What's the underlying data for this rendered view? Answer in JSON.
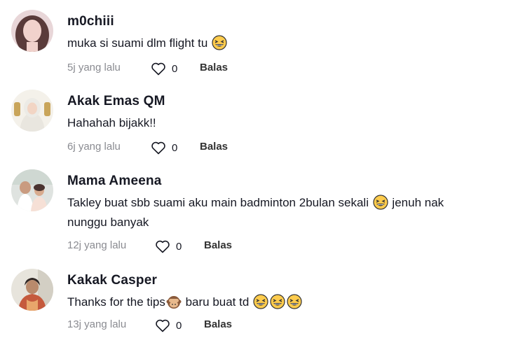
{
  "comments": [
    {
      "username": "m0chiii",
      "text_before": "muka si suami dlm flight tu ",
      "emoji_after": "grinning-squinting-emoji",
      "time": "5j yang lalu",
      "likes": "0",
      "reply": "Balas"
    },
    {
      "username": "Akak Emas QM",
      "text": "Hahahah bijakk!!",
      "time": "6j yang lalu",
      "likes": "0",
      "reply": "Balas"
    },
    {
      "username": "Mama Ameena",
      "text_line1_before": "Takley buat sbb suami aku main badminton 2bulan sekali ",
      "text_line1_after": " jenuh nak",
      "text_line2": "nunggu banyak",
      "time": "12j yang lalu",
      "likes": "0",
      "reply": "Balas"
    },
    {
      "username": "Kakak Casper",
      "text_before": "Thanks for the tips",
      "text_after": " baru buat td ",
      "emojis": [
        "see-no-evil-monkey-emoji",
        "grinning-squinting-emoji",
        "grinning-squinting-emoji",
        "grinning-squinting-emoji"
      ],
      "time": "13j yang lalu",
      "likes": "0",
      "reply": "Balas"
    }
  ],
  "colors": {
    "text": "#161823",
    "muted": "#8a8b91",
    "emoji_face": "#ffcc4d"
  }
}
